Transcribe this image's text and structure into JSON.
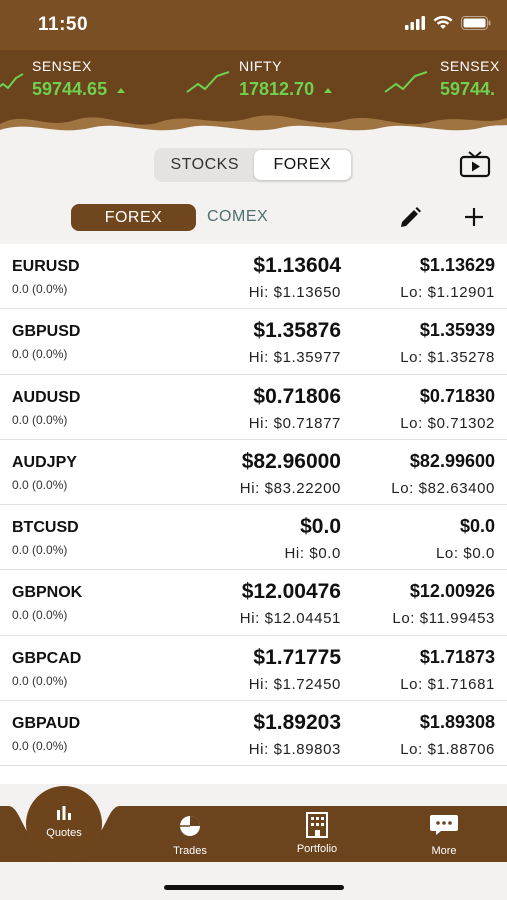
{
  "status": {
    "time": "11:50"
  },
  "ticker": [
    {
      "name": "SENSEX",
      "value": "59744.65"
    },
    {
      "name": "NIFTY",
      "value": "17812.70"
    },
    {
      "name": "SENSEX",
      "value": "59744."
    }
  ],
  "segment": {
    "stocks": "STOCKS",
    "forex": "FOREX",
    "selected": "FOREX"
  },
  "subtabs": {
    "forex": "FOREX",
    "comex": "COMEX",
    "selected": "FOREX"
  },
  "quotes": [
    {
      "symbol": "EURUSD",
      "change": "0.0 (0.0%)",
      "bid": "$1.13604",
      "ask": "$1.13629",
      "high": "Hi: $1.13650",
      "low": "Lo: $1.12901"
    },
    {
      "symbol": "GBPUSD",
      "change": "0.0 (0.0%)",
      "bid": "$1.35876",
      "ask": "$1.35939",
      "high": "Hi: $1.35977",
      "low": "Lo: $1.35278"
    },
    {
      "symbol": "AUDUSD",
      "change": "0.0 (0.0%)",
      "bid": "$0.71806",
      "ask": "$0.71830",
      "high": "Hi: $0.71877",
      "low": "Lo: $0.71302"
    },
    {
      "symbol": "AUDJPY",
      "change": "0.0 (0.0%)",
      "bid": "$82.96000",
      "ask": "$82.99600",
      "high": "Hi: $83.22200",
      "low": "Lo: $82.63400"
    },
    {
      "symbol": "BTCUSD",
      "change": "0.0 (0.0%)",
      "bid": "$0.0",
      "ask": "$0.0",
      "high": "Hi: $0.0",
      "low": "Lo: $0.0"
    },
    {
      "symbol": "GBPNOK",
      "change": "0.0 (0.0%)",
      "bid": "$12.00476",
      "ask": "$12.00926",
      "high": "Hi: $12.04451",
      "low": "Lo: $11.99453"
    },
    {
      "symbol": "GBPCAD",
      "change": "0.0 (0.0%)",
      "bid": "$1.71775",
      "ask": "$1.71873",
      "high": "Hi: $1.72450",
      "low": "Lo: $1.71681"
    },
    {
      "symbol": "GBPAUD",
      "change": "0.0 (0.0%)",
      "bid": "$1.89203",
      "ask": "$1.89308",
      "high": "Hi: $1.89803",
      "low": "Lo: $1.88706"
    }
  ],
  "tabs": {
    "quotes": "Quotes",
    "trades": "Trades",
    "portfolio": "Portfolio",
    "more": "More",
    "selected": "Quotes"
  },
  "colors": {
    "brand_brown": "#6b431d",
    "ticker_green": "#6fd14f"
  },
  "icons": {
    "tv": "tv-icon",
    "edit": "pencil-icon",
    "add": "plus-icon",
    "quotes": "bar-chart-icon",
    "trades": "pie-chart-icon",
    "portfolio": "building-icon",
    "more": "chat-bubble-icon"
  }
}
